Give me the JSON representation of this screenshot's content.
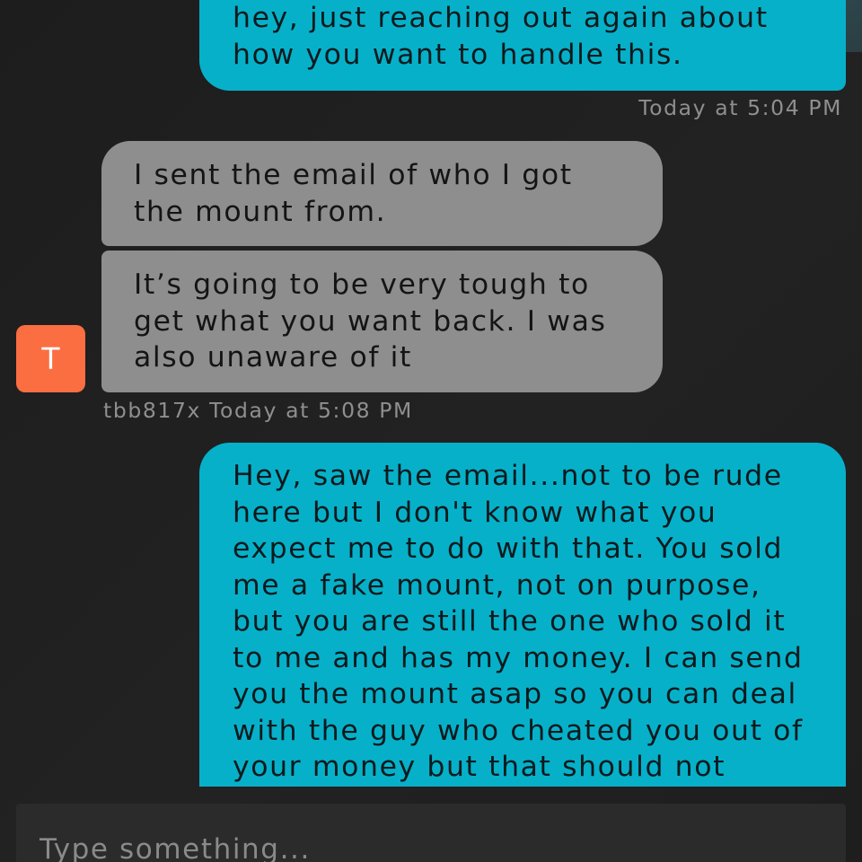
{
  "conversation": {
    "messages": [
      {
        "direction": "outgoing",
        "text": "hey, just reaching out again about\nhow you want to handle this."
      },
      {
        "direction": "incoming",
        "text": "I sent the email of who I got\nthe mount from."
      },
      {
        "direction": "incoming",
        "text": "It’s going to be very tough to\nget what you want back. I was\nalso unaware of it"
      },
      {
        "direction": "outgoing",
        "text": "Hey, saw the email...not to be rude\nhere but I don't know what you\nexpect me to do with that. You sold\nme a fake mount, not on purpose,\nbut you are still the one who sold it\nto me and has my money. I can send\nyou the mount asap so you can deal\nwith the guy who cheated you out of\nyour money but that should not"
      }
    ],
    "timestamps": {
      "outgoing_1": "Today at 5:04 PM",
      "incoming_group": "tbb817x Today at 5:08 PM"
    },
    "contact": {
      "avatar_initial": "T",
      "avatar_color": "#fb6e42"
    }
  },
  "composer": {
    "placeholder": "Type something..."
  },
  "colors": {
    "background": "#1f1f1f",
    "outgoing_bubble": "#07b0c9",
    "incoming_bubble": "#8e8e8e",
    "timestamp_text": "#8f8f8f"
  }
}
